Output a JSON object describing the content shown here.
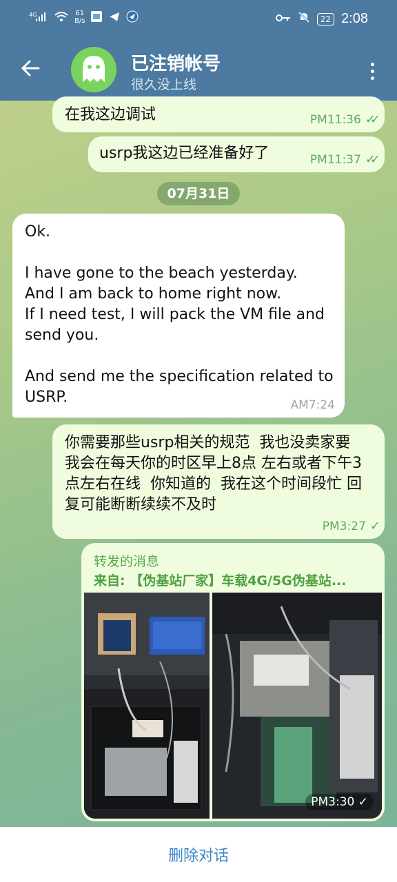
{
  "status_bar": {
    "network": "4G",
    "speed_value": "61",
    "speed_unit": "B/s",
    "battery": "22",
    "time": "2:08",
    "icons": [
      "signal-icon",
      "wifi-icon",
      "app-icon",
      "telegram-icon",
      "location-icon",
      "key-icon",
      "mute-icon"
    ]
  },
  "header": {
    "title": "已注销帐号",
    "subtitle": "很久没上线",
    "back_icon": "arrow-left-icon",
    "menu_icon": "more-vert-icon",
    "avatar_icon": "ghost-icon",
    "avatar_color": "#7ad35e"
  },
  "messages": [
    {
      "direction": "out",
      "text": "在我这边调试",
      "time": "PM11:36",
      "status": "read"
    },
    {
      "direction": "out",
      "text": "usrp我这边已经准备好了",
      "time": "PM11:37",
      "status": "read"
    },
    {
      "type": "date",
      "text": "07月31日"
    },
    {
      "direction": "in",
      "text": "Ok.\n\nI have gone to the beach yesterday.\nAnd I am back to home right now.\nIf I need test, I will pack the VM file and send you.\n\nAnd send me the specification related to USRP.",
      "time": "AM7:24"
    },
    {
      "direction": "out",
      "text": "你需要那些usrp相关的规范  我也没卖家要  我会在每天你的时区早上8点 左右或者下午3点左右在线  你知道的  我在这个时间段忙 回复可能断断续续不及时",
      "time": "PM3:27",
      "status": "sent"
    },
    {
      "direction": "out",
      "type": "forward",
      "forward_title": "转发的消息",
      "forward_from": "来自: 【伪基站厂家】车载4G/5G伪基站...",
      "photos": 2,
      "time": "PM3:30",
      "status": "sent"
    }
  ],
  "footer": {
    "delete_label": "删除对话"
  },
  "colors": {
    "header": "#4c7aa0",
    "outgoing": "#effdde",
    "incoming": "#ffffff",
    "accent": "#3f86c9",
    "check": "#5fa862"
  }
}
